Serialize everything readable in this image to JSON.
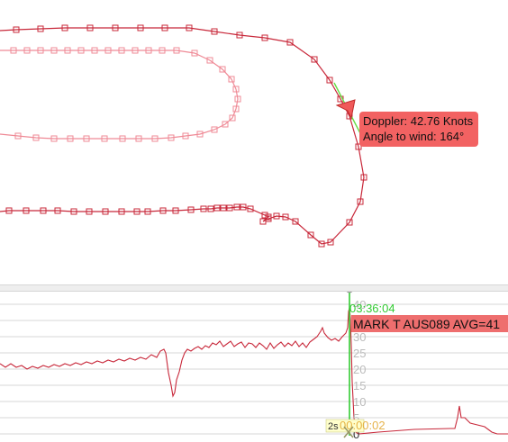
{
  "tooltip": {
    "line1": "Doppler: 42.76 Knots",
    "line2": "Angle to wind: 164°"
  },
  "colors": {
    "track_primary": "#c8283a",
    "track_secondary": "#ef8a96",
    "marker_fill": "#f05a5a",
    "tooltip_bg": "#f26262",
    "time_cursor": "#33cc33",
    "mark_label_bg": "#ee6e6e",
    "slider_text": "#e0a020"
  },
  "chart": {
    "time_label": "03:36:04",
    "mark_label": "MARK T AUS089 AVG=41",
    "slider_label": "2s",
    "slider_time": "00:00:02",
    "y_ticks": [
      "40",
      "35",
      "30",
      "25",
      "20",
      "15",
      "10",
      "5",
      "0"
    ]
  },
  "icons": {
    "boat": "boat-marker-icon",
    "track_point": "square-point-icon",
    "cursor_handle": "circle-handle-icon",
    "time_slider": "x-cursor-icon"
  }
}
